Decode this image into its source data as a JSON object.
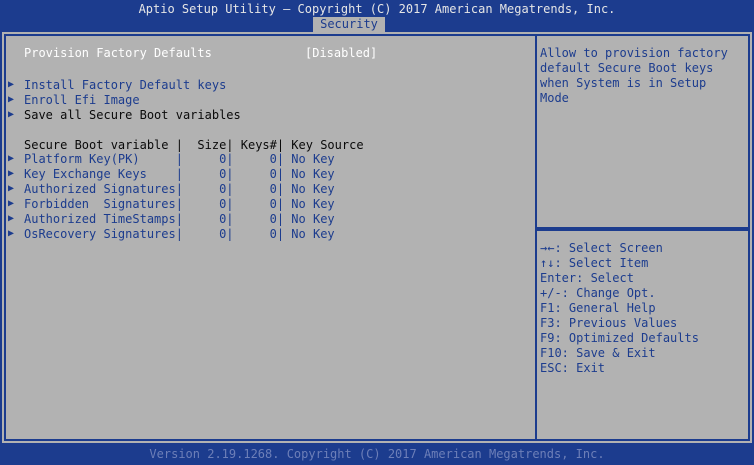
{
  "header": {
    "title": "Aptio Setup Utility – Copyright (C) 2017 American Megatrends, Inc.",
    "active_tab": "Security"
  },
  "settings": {
    "provision_label": "Provision Factory Defaults",
    "provision_value": "[Disabled]",
    "install_keys": "Install Factory Default keys",
    "enroll_efi": "Enroll Efi Image",
    "save_all": "Save all Secure Boot variables"
  },
  "table": {
    "header": "Secure Boot variable |  Size| Keys#| Key Source",
    "rows": [
      "Platform Key(PK)     |     0|     0| No Key",
      "Key Exchange Keys    |     0|     0| No Key",
      "Authorized Signatures|     0|     0| No Key",
      "Forbidden  Signatures|     0|     0| No Key",
      "Authorized TimeStamps|     0|     0| No Key",
      "OsRecovery Signatures|     0|     0| No Key"
    ]
  },
  "help": {
    "description": [
      "Allow to provision factory",
      "default Secure Boot keys",
      "when System is in Setup",
      "Mode"
    ],
    "keys": [
      "→←: Select Screen",
      "↑↓: Select Item",
      "Enter: Select",
      "+/-: Change Opt.",
      "F1: General Help",
      "F3: Previous Values",
      "F9: Optimized Defaults",
      "F10: Save & Exit",
      "ESC: Exit"
    ]
  },
  "footer": "Version 2.19.1268. Copyright (C) 2017 American Megatrends, Inc.",
  "colors": {
    "background": "#1c3c8e",
    "panel": "#b2b2b2",
    "highlight_text": "#ffffff",
    "item_text": "#1c3c8e"
  }
}
